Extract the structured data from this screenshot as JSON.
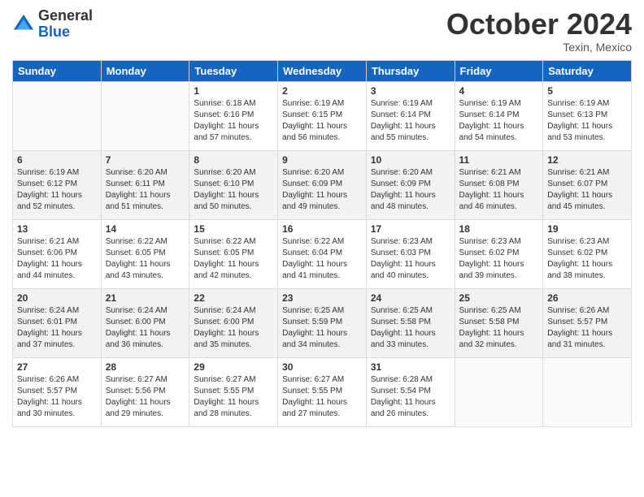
{
  "header": {
    "logo_general": "General",
    "logo_blue": "Blue",
    "month_title": "October 2024",
    "location": "Texin, Mexico"
  },
  "days_of_week": [
    "Sunday",
    "Monday",
    "Tuesday",
    "Wednesday",
    "Thursday",
    "Friday",
    "Saturday"
  ],
  "weeks": [
    [
      {
        "day": "",
        "info": ""
      },
      {
        "day": "",
        "info": ""
      },
      {
        "day": "1",
        "info": "Sunrise: 6:18 AM\nSunset: 6:16 PM\nDaylight: 11 hours and 57 minutes."
      },
      {
        "day": "2",
        "info": "Sunrise: 6:19 AM\nSunset: 6:15 PM\nDaylight: 11 hours and 56 minutes."
      },
      {
        "day": "3",
        "info": "Sunrise: 6:19 AM\nSunset: 6:14 PM\nDaylight: 11 hours and 55 minutes."
      },
      {
        "day": "4",
        "info": "Sunrise: 6:19 AM\nSunset: 6:14 PM\nDaylight: 11 hours and 54 minutes."
      },
      {
        "day": "5",
        "info": "Sunrise: 6:19 AM\nSunset: 6:13 PM\nDaylight: 11 hours and 53 minutes."
      }
    ],
    [
      {
        "day": "6",
        "info": "Sunrise: 6:19 AM\nSunset: 6:12 PM\nDaylight: 11 hours and 52 minutes."
      },
      {
        "day": "7",
        "info": "Sunrise: 6:20 AM\nSunset: 6:11 PM\nDaylight: 11 hours and 51 minutes."
      },
      {
        "day": "8",
        "info": "Sunrise: 6:20 AM\nSunset: 6:10 PM\nDaylight: 11 hours and 50 minutes."
      },
      {
        "day": "9",
        "info": "Sunrise: 6:20 AM\nSunset: 6:09 PM\nDaylight: 11 hours and 49 minutes."
      },
      {
        "day": "10",
        "info": "Sunrise: 6:20 AM\nSunset: 6:09 PM\nDaylight: 11 hours and 48 minutes."
      },
      {
        "day": "11",
        "info": "Sunrise: 6:21 AM\nSunset: 6:08 PM\nDaylight: 11 hours and 46 minutes."
      },
      {
        "day": "12",
        "info": "Sunrise: 6:21 AM\nSunset: 6:07 PM\nDaylight: 11 hours and 45 minutes."
      }
    ],
    [
      {
        "day": "13",
        "info": "Sunrise: 6:21 AM\nSunset: 6:06 PM\nDaylight: 11 hours and 44 minutes."
      },
      {
        "day": "14",
        "info": "Sunrise: 6:22 AM\nSunset: 6:05 PM\nDaylight: 11 hours and 43 minutes."
      },
      {
        "day": "15",
        "info": "Sunrise: 6:22 AM\nSunset: 6:05 PM\nDaylight: 11 hours and 42 minutes."
      },
      {
        "day": "16",
        "info": "Sunrise: 6:22 AM\nSunset: 6:04 PM\nDaylight: 11 hours and 41 minutes."
      },
      {
        "day": "17",
        "info": "Sunrise: 6:23 AM\nSunset: 6:03 PM\nDaylight: 11 hours and 40 minutes."
      },
      {
        "day": "18",
        "info": "Sunrise: 6:23 AM\nSunset: 6:02 PM\nDaylight: 11 hours and 39 minutes."
      },
      {
        "day": "19",
        "info": "Sunrise: 6:23 AM\nSunset: 6:02 PM\nDaylight: 11 hours and 38 minutes."
      }
    ],
    [
      {
        "day": "20",
        "info": "Sunrise: 6:24 AM\nSunset: 6:01 PM\nDaylight: 11 hours and 37 minutes."
      },
      {
        "day": "21",
        "info": "Sunrise: 6:24 AM\nSunset: 6:00 PM\nDaylight: 11 hours and 36 minutes."
      },
      {
        "day": "22",
        "info": "Sunrise: 6:24 AM\nSunset: 6:00 PM\nDaylight: 11 hours and 35 minutes."
      },
      {
        "day": "23",
        "info": "Sunrise: 6:25 AM\nSunset: 5:59 PM\nDaylight: 11 hours and 34 minutes."
      },
      {
        "day": "24",
        "info": "Sunrise: 6:25 AM\nSunset: 5:58 PM\nDaylight: 11 hours and 33 minutes."
      },
      {
        "day": "25",
        "info": "Sunrise: 6:25 AM\nSunset: 5:58 PM\nDaylight: 11 hours and 32 minutes."
      },
      {
        "day": "26",
        "info": "Sunrise: 6:26 AM\nSunset: 5:57 PM\nDaylight: 11 hours and 31 minutes."
      }
    ],
    [
      {
        "day": "27",
        "info": "Sunrise: 6:26 AM\nSunset: 5:57 PM\nDaylight: 11 hours and 30 minutes."
      },
      {
        "day": "28",
        "info": "Sunrise: 6:27 AM\nSunset: 5:56 PM\nDaylight: 11 hours and 29 minutes."
      },
      {
        "day": "29",
        "info": "Sunrise: 6:27 AM\nSunset: 5:55 PM\nDaylight: 11 hours and 28 minutes."
      },
      {
        "day": "30",
        "info": "Sunrise: 6:27 AM\nSunset: 5:55 PM\nDaylight: 11 hours and 27 minutes."
      },
      {
        "day": "31",
        "info": "Sunrise: 6:28 AM\nSunset: 5:54 PM\nDaylight: 11 hours and 26 minutes."
      },
      {
        "day": "",
        "info": ""
      },
      {
        "day": "",
        "info": ""
      }
    ]
  ]
}
